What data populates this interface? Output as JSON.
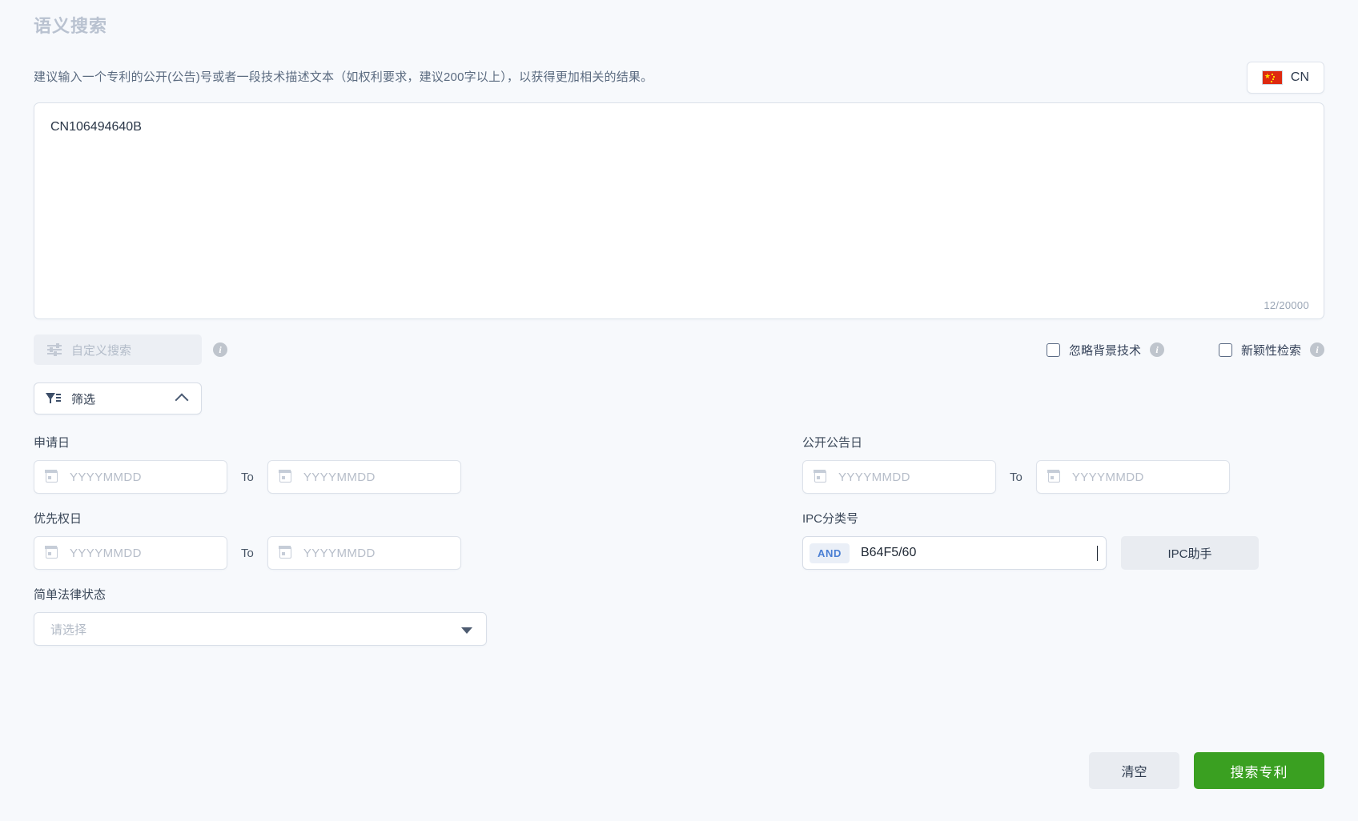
{
  "header": {
    "title": "语义搜索",
    "hint": "建议输入一个专利的公开(公告)号或者一段技术描述文本（如权利要求，建议200字以上），以获得更加相关的结果。",
    "language_button": {
      "label": "CN",
      "icon": "flag-cn-icon"
    }
  },
  "query": {
    "value": "CN106494640B",
    "placeholder": "",
    "char_counter": "12/20000",
    "max_length": 20000,
    "current_length": 12
  },
  "options": {
    "custom_search": {
      "label": "自定义搜索",
      "icon": "sliders-icon",
      "disabled": true,
      "info_icon": "info-icon"
    },
    "checkboxes": [
      {
        "label": "忽略背景技术",
        "checked": false,
        "info_icon": "info-icon"
      },
      {
        "label": "新颖性检索",
        "checked": false,
        "info_icon": "info-icon"
      }
    ]
  },
  "filter_toggle": {
    "label": "筛选",
    "icon": "funnel-icon",
    "chevron": "chevron-up-icon",
    "expanded": true
  },
  "filters": {
    "application_date": {
      "label": "申请日",
      "from_value": "",
      "from_placeholder": "YYYYMMDD",
      "separator": "To",
      "to_value": "",
      "to_placeholder": "YYYYMMDD"
    },
    "publication_date": {
      "label": "公开公告日",
      "from_value": "",
      "from_placeholder": "YYYYMMDD",
      "separator": "To",
      "to_value": "",
      "to_placeholder": "YYYYMMDD"
    },
    "priority_date": {
      "label": "优先权日",
      "from_value": "",
      "from_placeholder": "YYYYMMDD",
      "separator": "To",
      "to_value": "",
      "to_placeholder": "YYYYMMDD"
    },
    "ipc": {
      "label": "IPC分类号",
      "operator_badge": "AND",
      "value": "B64F5/60",
      "placeholder": "",
      "helper_button": "IPC助手"
    },
    "legal_status": {
      "label": "简单法律状态",
      "selected": "",
      "placeholder": "请选择"
    }
  },
  "actions": {
    "clear_label": "清空",
    "search_label": "搜索专利"
  },
  "colors": {
    "page_background": "#f7f9fc",
    "primary_green": "#3aa021",
    "title_gray": "#b9c2d0",
    "and_badge_blue": "#4a7fd4",
    "flag_red": "#de2910",
    "flag_yellow": "#ffde00"
  }
}
